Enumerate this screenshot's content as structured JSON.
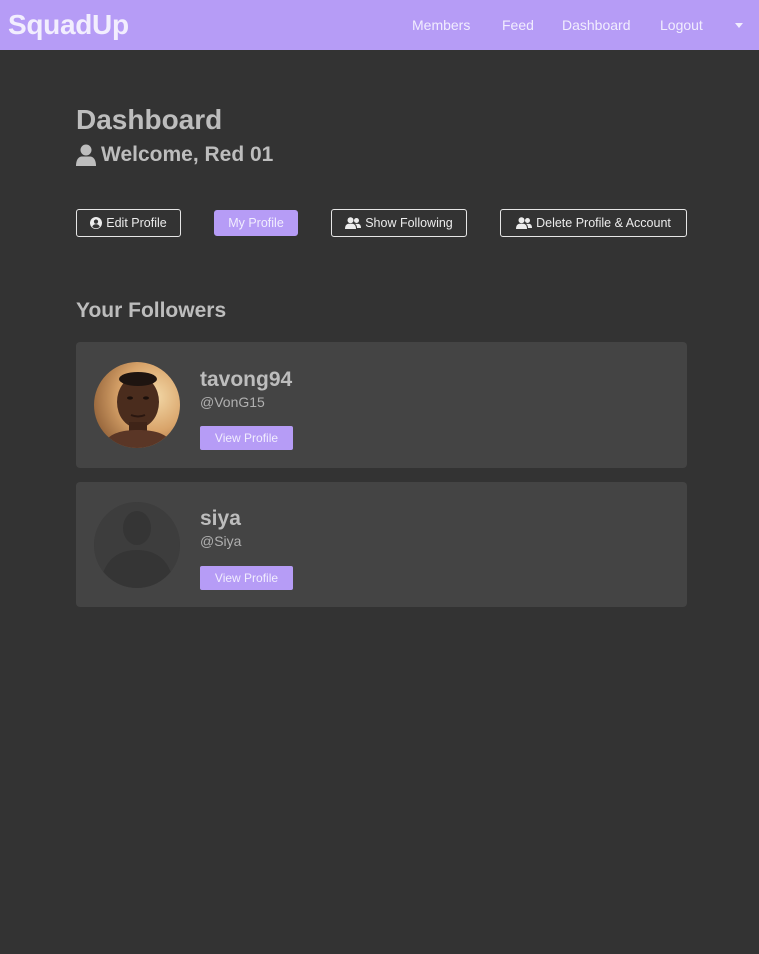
{
  "navbar": {
    "brand": "SquadUp",
    "links": [
      "Members",
      "Feed",
      "Dashboard",
      "Logout"
    ],
    "background": "#b69cf6"
  },
  "dashboard": {
    "title": "Dashboard",
    "welcome": "Welcome, Red 01",
    "buttons": {
      "edit_profile": "Edit Profile",
      "my_profile": "My Profile",
      "show_following": "Show Following",
      "delete_profile": "Delete Profile & Account"
    }
  },
  "followers": {
    "title": "Your Followers",
    "items": [
      {
        "username": "tavong94",
        "handle": "@VonG15",
        "button": "View Profile",
        "avatar": "photo"
      },
      {
        "username": "siya",
        "handle": "@Siya",
        "button": "View Profile",
        "avatar": "default-silhouette"
      }
    ]
  },
  "colors": {
    "accent": "#b69cf6",
    "page_bg": "#333333",
    "card_bg": "#444444"
  }
}
